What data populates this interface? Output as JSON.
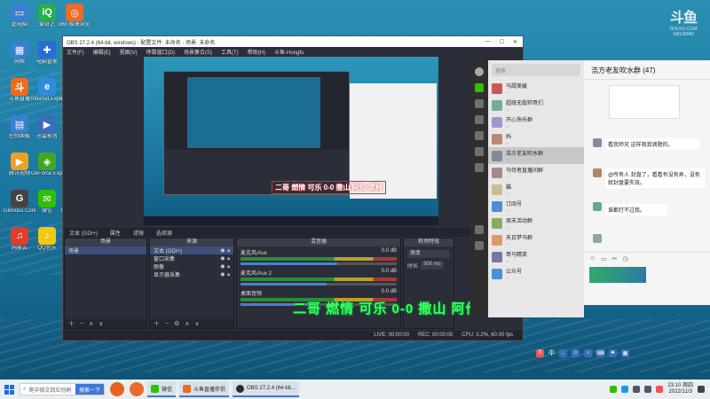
{
  "desktop": {
    "icons": [
      {
        "label": "此电脑",
        "color": "#3b7fd0",
        "glyph": "▭"
      },
      {
        "label": "爱奇艺",
        "color": "#22b14c",
        "glyph": "iQ"
      },
      {
        "label": "360 极速浏览器",
        "color": "#e86c2a",
        "glyph": "◎"
      },
      {
        "label": "网络",
        "color": "#3b7fd0",
        "glyph": "▦"
      },
      {
        "label": "电脑管家",
        "color": "#2a6cd6",
        "glyph": "✚"
      },
      {
        "label": "回收站",
        "color": "#8aa",
        "glyph": "♲"
      },
      {
        "label": "斗鱼直播",
        "color": "#f06a1d",
        "glyph": "斗"
      },
      {
        "label": "Internet Explorer",
        "color": "#2f8be0",
        "glyph": "e"
      },
      {
        "label": "斗鱼直播伴侣",
        "color": "#f06a1d",
        "glyph": "斗"
      },
      {
        "label": "控制面板",
        "color": "#3b7fd0",
        "glyph": "▤"
      },
      {
        "label": "迅雷影音",
        "color": "#3a6dbb",
        "glyph": "▶"
      },
      {
        "label": "Firefox",
        "color": "#e5621f",
        "glyph": "◍"
      },
      {
        "label": "腾讯视频",
        "color": "#f0a020",
        "glyph": "▶"
      },
      {
        "label": "GeForce Experience",
        "color": "#3fa81e",
        "glyph": "◈"
      },
      {
        "label": "腾讯QQ",
        "color": "#1d98e8",
        "glyph": "Q"
      },
      {
        "label": "Glorious Core",
        "color": "#444",
        "glyph": "G"
      },
      {
        "label": "微信",
        "color": "#2dc100",
        "glyph": "✉"
      },
      {
        "label": "OBS Studio",
        "color": "#2a2a2a",
        "glyph": "◉"
      },
      {
        "label": "网易云",
        "color": "#e23c2c",
        "glyph": "♫"
      },
      {
        "label": "QQ音乐",
        "color": "#f2c80f",
        "glyph": "♪"
      },
      {
        "label": "1.jpg",
        "color": "#c7a",
        "glyph": "▣"
      }
    ]
  },
  "douyu": {
    "logo": "斗鱼",
    "sub": "DOUYU.COM",
    "room": "5919940"
  },
  "obs": {
    "title": "OBS 27.2.4 (64-bit, windows) - 配置文件: 未命名 - 场景: 未命名",
    "menu": [
      "文件(F)",
      "编辑(E)",
      "视图(V)",
      "停靠窗口(D)",
      "场景集合(S)",
      "工具(T)",
      "帮助(H)",
      "斗鱼-Hongfu"
    ],
    "source_bar": [
      "文本 (GDI+)",
      "属性",
      "滤镜",
      "选择源"
    ],
    "docks": {
      "scenes": {
        "title": "场景",
        "items": [
          "场景"
        ]
      },
      "sources": {
        "title": "来源",
        "items": [
          "文本 (GDI+)",
          "窗口采集",
          "图像",
          "显示器采集"
        ]
      },
      "mixer": {
        "title": "混音器",
        "channels": [
          {
            "name": "麦克风/Aux",
            "level": 0.62,
            "db": "0.0 dB"
          },
          {
            "name": "麦克风/Aux 2",
            "level": 0.55,
            "db": "0.0 dB"
          },
          {
            "name": "桌面音频",
            "level": 0.48,
            "db": "0.0 dB"
          }
        ]
      },
      "transitions": {
        "title": "转场特效",
        "type": "渐变",
        "duration_label": "时长",
        "duration": "300 ms"
      }
    },
    "status": [
      "LIVE: 00:00:00",
      "REC: 00:00:00",
      "CPU: 3.2%, 60.00 fps"
    ],
    "preview_overlay": "二哥 燃情 可乐 0-0 撒山 阿伦 求种"
  },
  "overlay_text": "二哥 燃情 可乐 0-0 撒山 阿伦 求种",
  "wechat": {
    "search_placeholder": "搜索",
    "chats": [
      {
        "name": "马甜美媛",
        "preview": "...",
        "color": "#c55"
      },
      {
        "name": "超级无敌帅哥们",
        "preview": "...",
        "color": "#7a9"
      },
      {
        "name": "开心快乐群",
        "preview": "...",
        "color": "#99c"
      },
      {
        "name": "妈",
        "preview": "...",
        "color": "#b87"
      },
      {
        "name": "浩方老友吹水群",
        "preview": "...",
        "color": "#889",
        "selected": true
      },
      {
        "name": "马侍者直播间群",
        "preview": "...",
        "color": "#a88"
      },
      {
        "name": "猫",
        "preview": "...",
        "color": "#cb9"
      },
      {
        "name": "订阅号",
        "preview": "...",
        "color": "#4a8fd8"
      },
      {
        "name": "周末活动群",
        "preview": "...",
        "color": "#8a6"
      },
      {
        "name": "天日梦马群",
        "preview": "...",
        "color": "#d96"
      },
      {
        "name": "哥马精英",
        "preview": "...",
        "color": "#779"
      },
      {
        "name": "公众号",
        "preview": "...",
        "color": "#4a8fd8"
      }
    ],
    "chat_title": "浩方老友吹水群 (47)",
    "messages": [
      "看我师兄 这样就我滴题的。",
      "@所有人 封盘了，看看有没有弄，没有就封盘要失效。",
      "谁都打不过我。"
    ]
  },
  "ime": {
    "label": "中"
  },
  "taskbar": {
    "search_text": "爬中宿文回应别刷",
    "search_button": "搜索一下",
    "tasks": [
      "微信",
      "斗鱼直播伴侣",
      "OBS 27.2.4 (64-bit..."
    ],
    "time": "23:10 周四",
    "date": "2022/11/3"
  }
}
